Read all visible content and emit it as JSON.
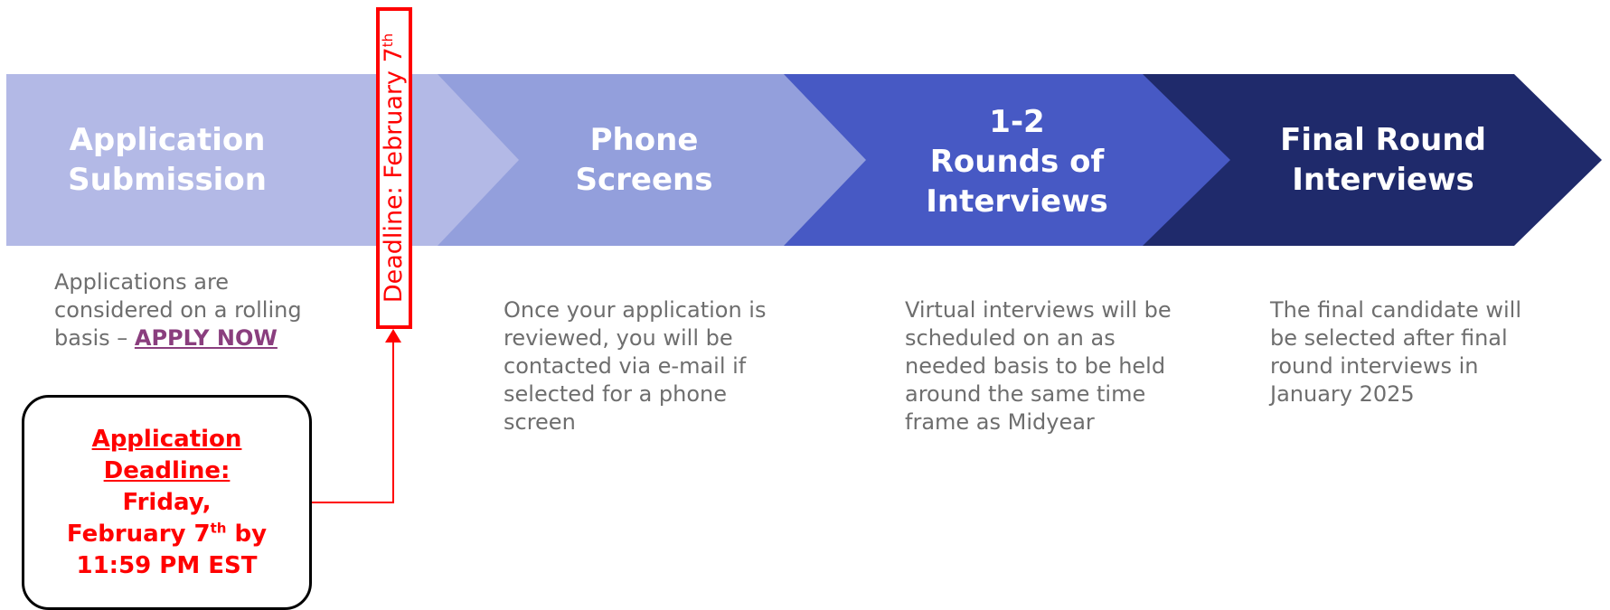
{
  "stages": [
    {
      "title_lines": [
        "Application",
        "Submission"
      ],
      "color": "#b3b9e6"
    },
    {
      "title_lines": [
        "Phone",
        "Screens"
      ],
      "color": "#939fdc"
    },
    {
      "title_lines": [
        "1-2",
        "Rounds of",
        "Interviews"
      ],
      "color": "#4759c4"
    },
    {
      "title_lines": [
        "Final Round",
        "Interviews"
      ],
      "color": "#1f2a6b"
    }
  ],
  "descriptions": {
    "application": {
      "lines": [
        "Applications are",
        "considered on a rolling"
      ],
      "prefix": "basis – ",
      "link": "APPLY NOW"
    },
    "phone": {
      "lines": [
        "Once your application is",
        "reviewed, you will be",
        "contacted via e-mail if",
        "selected for a phone",
        "screen"
      ]
    },
    "rounds": {
      "lines": [
        "Virtual interviews will be",
        "scheduled on an as",
        "needed basis to be held",
        "around the same time",
        "frame as Midyear"
      ]
    },
    "final": {
      "lines": [
        "The final candidate will",
        "be selected after final",
        "round interviews in",
        "January 2025"
      ]
    }
  },
  "deadline_marker": {
    "text": "Deadline: February 7",
    "sup": "th",
    "color": "#ff0000"
  },
  "deadline_box": {
    "heading_lines": [
      "Application",
      "Deadline:"
    ],
    "day": "Friday,",
    "date_prefix": "February 7",
    "date_sup": "th",
    "date_suffix": " by",
    "time": "11:59 PM EST"
  }
}
